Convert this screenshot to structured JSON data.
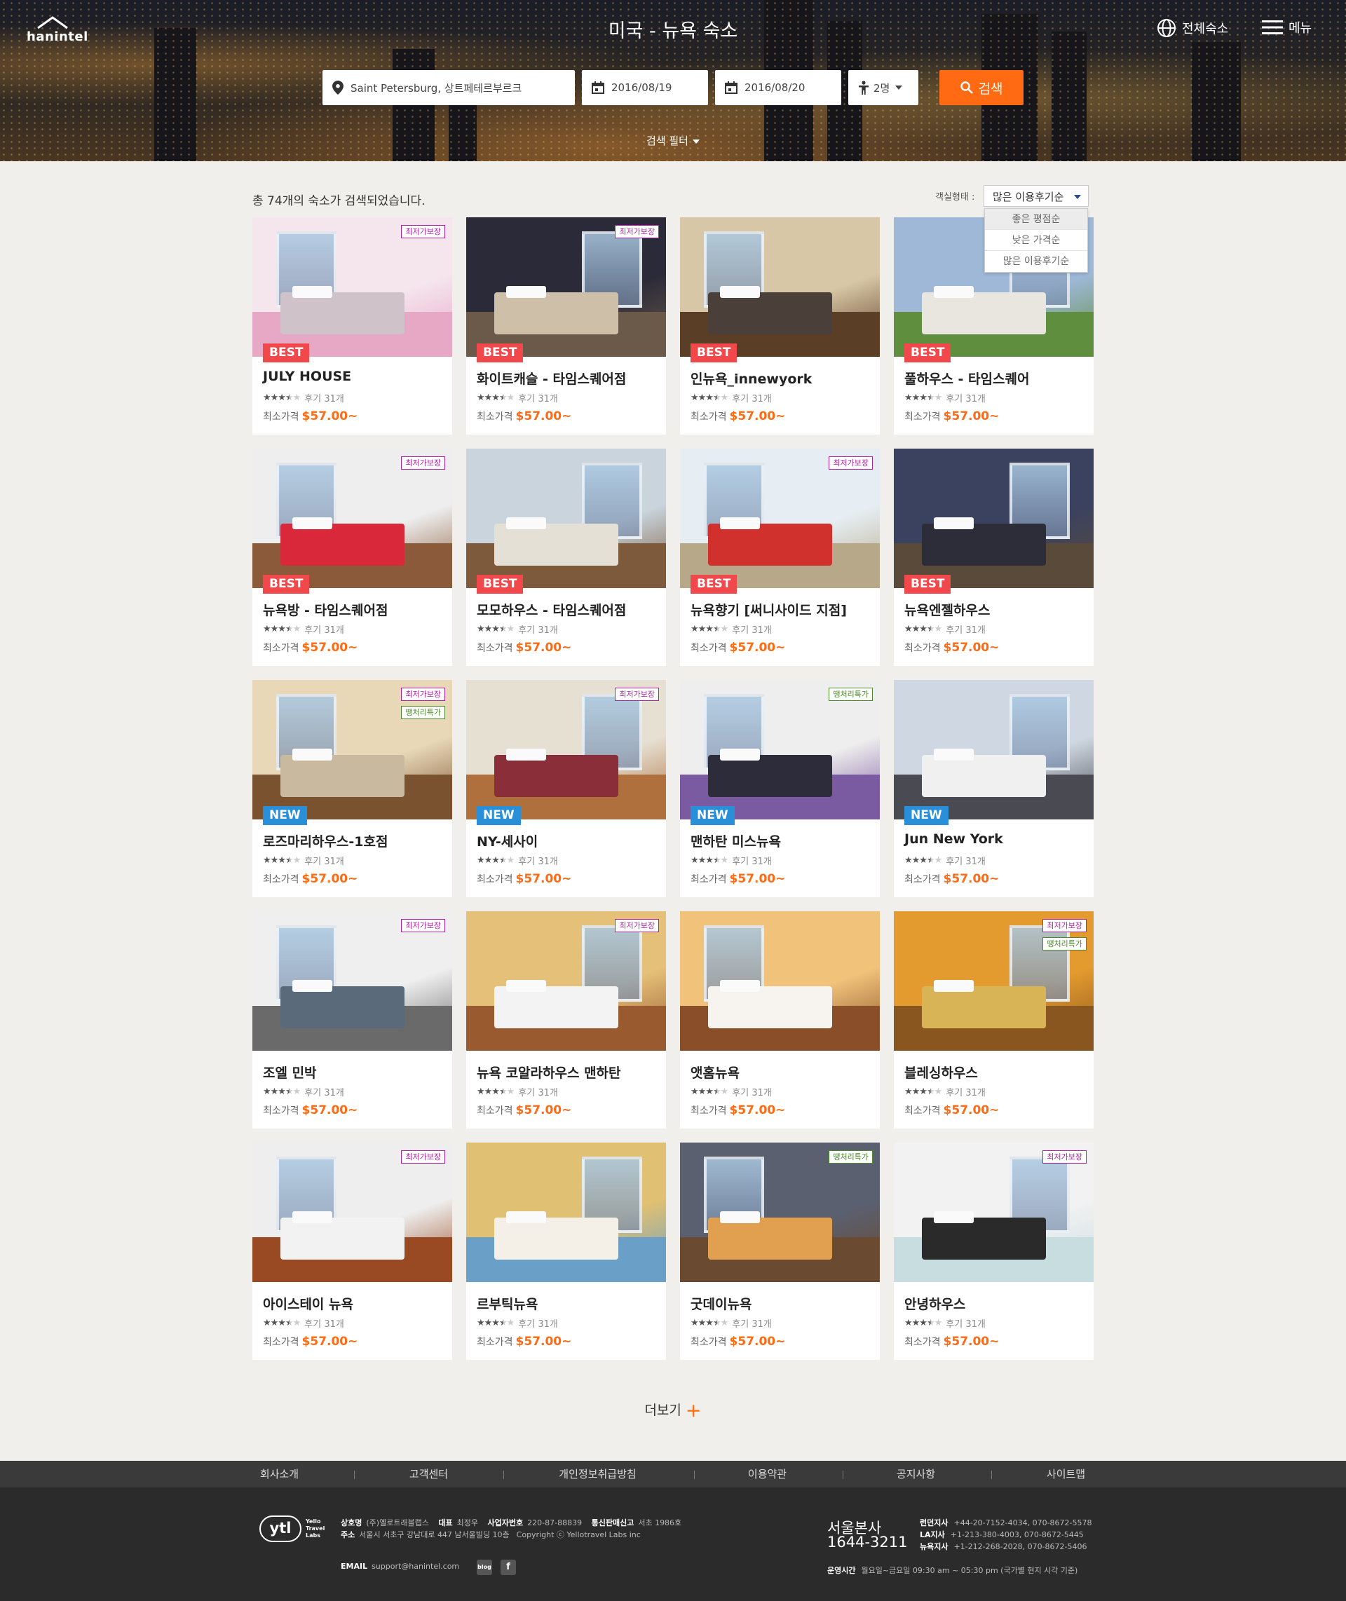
{
  "header": {
    "logo_text": "hanintel",
    "title": "미국 - 뉴욕 숙소",
    "all_stays_label": "전체숙소",
    "menu_label": "메뉴"
  },
  "search": {
    "location": "Saint Petersburg, 상트페테르부르크",
    "checkin": "2016/08/19",
    "checkout": "2016/08/20",
    "guests": "2명",
    "button": "검색",
    "filter_toggle": "검색 필터"
  },
  "results": {
    "count_text": "총 74개의 숙소가 검색되었습니다.",
    "sort_label": "객실형태 :",
    "sort_selected": "많은 이용후기순",
    "sort_options": [
      "좋은 평점순",
      "낮은 가격순",
      "많은 이용후기순"
    ]
  },
  "labels": {
    "review_prefix": "후기",
    "price_prefix": "최소가격",
    "tag_lowest": "최저가보장",
    "tag_lastminute": "땡처리특가",
    "ribbon_best": "BEST",
    "ribbon_new": "NEW"
  },
  "listings": [
    {
      "name": "JULY HOUSE",
      "reviews": "31개",
      "price": "$57.00~",
      "rating": 3.5,
      "ribbon": "BEST",
      "tags": [
        "최저가보장"
      ],
      "palette": [
        "#f5e6ee",
        "#e7a8c6",
        "#cfc2c8"
      ]
    },
    {
      "name": "화이트캐슬 - 타임스퀘어점",
      "reviews": "31개",
      "price": "$57.00~",
      "rating": 3.5,
      "ribbon": "BEST",
      "tags": [
        "최저가보장"
      ],
      "palette": [
        "#2a2a38",
        "#6b5a4a",
        "#cdbfa8"
      ]
    },
    {
      "name": "인뉴욕_innewyork",
      "reviews": "31개",
      "price": "$57.00~",
      "rating": 3.5,
      "ribbon": "BEST",
      "tags": [],
      "palette": [
        "#d8c7a6",
        "#5a3e25",
        "#4a3f39"
      ]
    },
    {
      "name": "풀하우스 - 타임스퀘어",
      "reviews": "31개",
      "price": "$57.00~",
      "rating": 3.5,
      "ribbon": "BEST",
      "tags": [],
      "palette": [
        "#9fb8d8",
        "#5f8e3e",
        "#e9e6df"
      ]
    },
    {
      "name": "뉴욕방 - 타임스퀘어점",
      "reviews": "31개",
      "price": "$57.00~",
      "rating": 3.5,
      "ribbon": "BEST",
      "tags": [
        "최저가보장"
      ],
      "palette": [
        "#eeeeee",
        "#8a5a3a",
        "#d8283a"
      ]
    },
    {
      "name": "모모하우스 - 타임스퀘어점",
      "reviews": "31개",
      "price": "$57.00~",
      "rating": 3.5,
      "ribbon": "BEST",
      "tags": [],
      "palette": [
        "#c9d4dc",
        "#7d5a3c",
        "#e4e0d6"
      ]
    },
    {
      "name": "뉴욕향기 [써니사이드 지점]",
      "reviews": "31개",
      "price": "$57.00~",
      "rating": 3.5,
      "ribbon": "BEST",
      "tags": [
        "최저가보장"
      ],
      "palette": [
        "#e6eef3",
        "#b8a88a",
        "#d0312d"
      ]
    },
    {
      "name": "뉴욕엔젤하우스",
      "reviews": "31개",
      "price": "$57.00~",
      "rating": 3.5,
      "ribbon": "BEST",
      "tags": [],
      "palette": [
        "#3b4260",
        "#5a4a3a",
        "#2d2d3a"
      ]
    },
    {
      "name": "로즈마리하우스-1호점",
      "reviews": "31개",
      "price": "$57.00~",
      "rating": 3.5,
      "ribbon": "NEW",
      "tags": [
        "최저가보장",
        "땡처리특가"
      ],
      "palette": [
        "#e8d8b8",
        "#7a5230",
        "#c9b99e"
      ]
    },
    {
      "name": "NY-세사이",
      "reviews": "31개",
      "price": "$57.00~",
      "rating": 3.5,
      "ribbon": "NEW",
      "tags": [
        "최저가보장"
      ],
      "palette": [
        "#e6e0d2",
        "#b0703e",
        "#8a2f3a"
      ]
    },
    {
      "name": "맨하탄 미스뉴욕",
      "reviews": "31개",
      "price": "$57.00~",
      "rating": 3.5,
      "ribbon": "NEW",
      "tags": [
        "땡처리특가"
      ],
      "palette": [
        "#eeeeee",
        "#7a5aa0",
        "#2c2c3a"
      ]
    },
    {
      "name": "Jun New York",
      "reviews": "31개",
      "price": "$57.00~",
      "rating": 3.5,
      "ribbon": "NEW",
      "tags": [],
      "palette": [
        "#cfd8e2",
        "#4a4a52",
        "#f0f0f0"
      ]
    },
    {
      "name": "조엘 민박",
      "reviews": "31개",
      "price": "$57.00~",
      "rating": 3.5,
      "ribbon": "",
      "tags": [
        "최저가보장"
      ],
      "palette": [
        "#efefef",
        "#6a6a6a",
        "#5a6a7a"
      ]
    },
    {
      "name": "뉴욕 코알라하우스 맨하탄",
      "reviews": "31개",
      "price": "$57.00~",
      "rating": 3.5,
      "ribbon": "",
      "tags": [
        "최저가보장"
      ],
      "palette": [
        "#e5c078",
        "#9a5a30",
        "#f3f3f3"
      ]
    },
    {
      "name": "앳홈뉴욕",
      "reviews": "31개",
      "price": "$57.00~",
      "rating": 3.5,
      "ribbon": "",
      "tags": [],
      "palette": [
        "#f0c27a",
        "#8a4e28",
        "#f7f3ee"
      ]
    },
    {
      "name": "블레싱하우스",
      "reviews": "31개",
      "price": "$57.00~",
      "rating": 3.5,
      "ribbon": "",
      "tags": [
        "최저가보장",
        "땡처리특가"
      ],
      "palette": [
        "#e39a2e",
        "#8a5620",
        "#d9b457"
      ]
    },
    {
      "name": "아이스테이 뉴욕",
      "reviews": "31개",
      "price": "$57.00~",
      "rating": 3.5,
      "ribbon": "",
      "tags": [
        "최저가보장"
      ],
      "palette": [
        "#eeeeee",
        "#9a4a22",
        "#f2f2f2"
      ]
    },
    {
      "name": "르부틱뉴욕",
      "reviews": "31개",
      "price": "$57.00~",
      "rating": 3.5,
      "ribbon": "",
      "tags": [],
      "palette": [
        "#e0c072",
        "#6aa0c8",
        "#f4f0e8"
      ]
    },
    {
      "name": "굿데이뉴욕",
      "reviews": "31개",
      "price": "$57.00~",
      "rating": 3.5,
      "ribbon": "",
      "tags": [
        "땡처리특가"
      ],
      "palette": [
        "#5a6070",
        "#6a4a30",
        "#e0a050"
      ]
    },
    {
      "name": "안녕하우스",
      "reviews": "31개",
      "price": "$57.00~",
      "rating": 3.5,
      "ribbon": "",
      "tags": [
        "최저가보장"
      ],
      "palette": [
        "#f2f2f2",
        "#c8dde0",
        "#2a2a2a"
      ]
    }
  ],
  "more_label": "더보기",
  "footer": {
    "nav": [
      "회사소개",
      "고객센터",
      "개인정보취급방침",
      "이용약관",
      "공지사항",
      "사이트맵"
    ],
    "logo_text": "ytl",
    "logo_sub": [
      "Yello",
      "Travel",
      "Labs"
    ],
    "company": {
      "name_label": "상호명",
      "name": "(주)옐로트래블랩스",
      "ceo_label": "대표",
      "ceo": "최정우",
      "bizno_label": "사업자번호",
      "bizno": "220-87-88839",
      "sales_label": "통신판매신고",
      "sales": "서초 1986호",
      "addr_label": "주소",
      "addr": "서울시 서초구 강남대로 447 남서울빌딩 10층",
      "copyright": "Copyright ⓒ Yellotravel Labs inc",
      "email_label": "EMAIL",
      "email": "support@hanintel.com"
    },
    "social": {
      "blog": "blog",
      "facebook": "f"
    },
    "hq": {
      "name": "서울본사",
      "phone": "1644-3211"
    },
    "branches": [
      {
        "label": "런던지사",
        "phone": "+44-20-7152-4034, 070-8672-5578"
      },
      {
        "label": "LA지사",
        "phone": "+1-213-380-4003, 070-8672-5445"
      },
      {
        "label": "뉴욕지사",
        "phone": "+1-212-268-2028, 070-8672-5406"
      }
    ],
    "hours_label": "운영시간",
    "hours": "월요일~금요일 09:30 am ~ 05:30 pm (국가별 현지 시각 기준)"
  }
}
